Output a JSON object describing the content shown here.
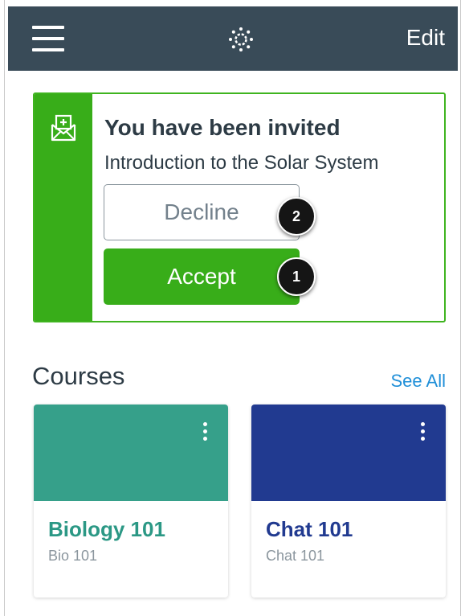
{
  "header": {
    "edit_label": "Edit",
    "menu_icon": "hamburger-menu-icon",
    "logo_icon": "canvas-logo-icon",
    "background_color": "#394b58"
  },
  "invitation": {
    "title": "You have been invited",
    "course_name": "Introduction to the Solar System",
    "decline_label": "Decline",
    "accept_label": "Accept",
    "icon": "invitation-envelope-icon",
    "accent_color": "#38ad19"
  },
  "callouts": {
    "decline_number": "2",
    "accept_number": "1"
  },
  "courses": {
    "heading": "Courses",
    "see_all_label": "See All",
    "items": [
      {
        "name": "Biology 101",
        "code": "Bio 101",
        "color": "#36a08a"
      },
      {
        "name": "Chat 101",
        "code": "Chat 101",
        "color": "#213a90"
      }
    ]
  }
}
